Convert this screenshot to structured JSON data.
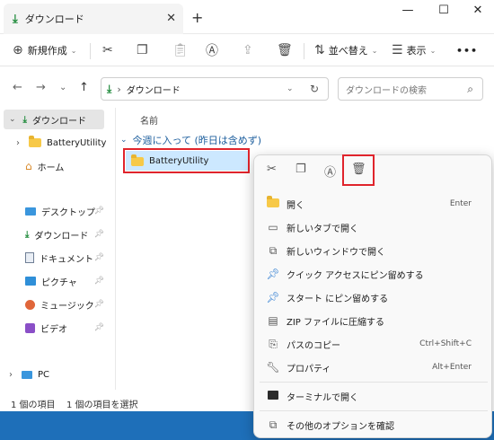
{
  "window": {
    "tab_title": "ダウンロード",
    "close_tab": "✕",
    "new_tab": "+",
    "minimize": "—",
    "maximize": "☐",
    "close": "✕"
  },
  "toolbar": {
    "new_label": "新規作成",
    "sort_label": "並べ替え",
    "view_label": "表示",
    "more": "•••"
  },
  "address": {
    "crumb": "ダウンロード",
    "search_placeholder": "ダウンロードの検索"
  },
  "sidebar": {
    "items": [
      {
        "label": "ダウンロード",
        "icon": "download-icon"
      },
      {
        "label": "BatteryUtility",
        "icon": "folder-icon"
      },
      {
        "label": "ホーム",
        "icon": "home-icon"
      },
      {
        "label": "デスクトップ",
        "icon": "desktop-icon"
      },
      {
        "label": "ダウンロード",
        "icon": "download-icon"
      },
      {
        "label": "ドキュメント",
        "icon": "document-icon"
      },
      {
        "label": "ピクチャ",
        "icon": "picture-icon"
      },
      {
        "label": "ミュージック",
        "icon": "music-icon"
      },
      {
        "label": "ビデオ",
        "icon": "video-icon"
      },
      {
        "label": "PC",
        "icon": "pc-icon"
      }
    ]
  },
  "content": {
    "column_header": "名前",
    "group_label": "今週に入って (昨日は含めず)",
    "item_name": "BatteryUtility"
  },
  "status": {
    "count": "1 個の項目",
    "selected": "1 個の項目を選択"
  },
  "context_menu": {
    "items": [
      {
        "label": "開く",
        "shortcut": "Enter",
        "icon": "folder-open-icon"
      },
      {
        "label": "新しいタブで開く",
        "shortcut": "",
        "icon": "new-tab-icon"
      },
      {
        "label": "新しいウィンドウで開く",
        "shortcut": "",
        "icon": "new-window-icon"
      },
      {
        "label": "クイック アクセスにピン留めする",
        "shortcut": "",
        "icon": "pin-icon"
      },
      {
        "label": "スタート にピン留めする",
        "shortcut": "",
        "icon": "pin-icon"
      },
      {
        "label": "ZIP ファイルに圧縮する",
        "shortcut": "",
        "icon": "zip-icon"
      },
      {
        "label": "パスのコピー",
        "shortcut": "Ctrl+Shift+C",
        "icon": "copy-path-icon"
      },
      {
        "label": "プロパティ",
        "shortcut": "Alt+Enter",
        "icon": "wrench-icon"
      },
      {
        "label": "ターミナルで開く",
        "shortcut": "",
        "icon": "terminal-icon"
      },
      {
        "label": "その他のオプションを確認",
        "shortcut": "",
        "icon": "more-options-icon"
      }
    ]
  },
  "colors": {
    "accent": "#1e6fb9",
    "highlight_box": "#e0242c",
    "selection": "#cce8ff",
    "folder": "#f7c948"
  }
}
